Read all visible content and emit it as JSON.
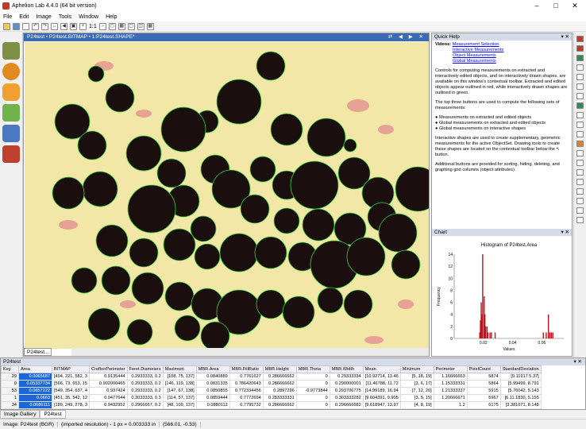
{
  "window": {
    "title": "Aphelion Lab 4.4.0 (64 bit version)"
  },
  "menu": [
    "File",
    "Edit",
    "Image",
    "Tools",
    "Window",
    "Help"
  ],
  "toolbar": {
    "zoom_label": "1:1"
  },
  "document": {
    "title": "P24test • P24test.BITMAP • 1:P24test.SHAPE*",
    "tab": "P24test..."
  },
  "quick_help": {
    "header": "Quick Help",
    "videos_label": "Videos:",
    "links": [
      "Measurement Selection",
      "Interactive Measurements",
      "Object Measurements",
      "Global Measurements"
    ],
    "para1": "Controls for computing measurements on extracted and interactively edited objects, and on interactively drawn shapes, are available on this window's contextual toolbar. Extracted and edited objects appear outlined in red, while interactively drawn shapes are outlined in green.",
    "para2": "The top three buttons are used to compute the following sets of measurements:",
    "bullets": [
      "Measurements on extracted and edited objects",
      "Global measurements on extracted and edited objects",
      "Global measurements on interactive shapes"
    ],
    "para3": "Interactive shapes are used to create supplementary, geometric measurements for the active ObjectSet. Drawing tools to create these shapes are located on the contextual toolbar below the",
    "para3_end": "button.",
    "para4": "Additional buttons are provided for sorting, hiding, deleting, and graphing grid columns (object attributes)."
  },
  "chart_panel": {
    "header": "Chart"
  },
  "chart_data": {
    "type": "bar",
    "title": "Histogram of P24test.Area",
    "xlabel": "Values",
    "ylabel": "Frequency",
    "xlim": [
      0,
      0.075
    ],
    "ylim": [
      0,
      14
    ],
    "x_ticks": [
      "0.02",
      "0.04",
      "0.06"
    ],
    "y_ticks": [
      "0",
      "2",
      "4",
      "6",
      "8",
      "10",
      "12",
      "14"
    ],
    "x": [
      0.0175,
      0.018,
      0.0185,
      0.019,
      0.0195,
      0.0205,
      0.021,
      0.0215,
      0.0225,
      0.023,
      0.0245,
      0.0255,
      0.028,
      0.061,
      0.063,
      0.0645,
      0.0655,
      0.0665,
      0.0675
    ],
    "values": [
      1,
      3,
      6,
      4,
      14,
      7,
      4,
      2,
      2,
      1,
      1,
      1,
      1,
      1,
      1,
      4,
      1,
      1,
      1
    ]
  },
  "table": {
    "title": "P24test",
    "columns": [
      "Key",
      "Area",
      "BITMAP",
      "CroftonPerimeter",
      "Feret.Diameters",
      "Maximum",
      "MBR.Area",
      "MBR.FillRatio",
      "MBR.Height",
      "MBR.Theta",
      "MBR.Width",
      "Mean",
      "Minimum",
      "Perimeter",
      "PixelCount",
      "StandardDeviation"
    ],
    "rows": [
      [
        "29",
        "0.0065687",
        "[494, 221, 582, 3",
        "0.9135444",
        "0.2933333, 0.2",
        "[108, 75, 137]",
        "0.0840889",
        "0.7761627",
        "0.286666662",
        "0",
        "0.29333334",
        "[10.92714, 13.46",
        "[5, 18, 19]",
        "1.16666663",
        "5874",
        "[9.11917 5.37]"
      ],
      [
        "0",
        "0.05337734",
        "[566, 73, 653, 15",
        "0.902000465",
        "0.2933333, 0.2",
        "[146, 119, 138]",
        "0.0831335",
        "0.786420643",
        "0.286666662",
        "0",
        "0.290000001",
        "[11.46788, 11.72",
        "[3, 6, 17]",
        "1.15333331",
        "5864",
        "[5.99499, 8.791"
      ],
      [
        "53",
        "0.0657222",
        "[549, 354, 637, 4",
        "0.937424",
        "0.2933333, 0.2",
        "[147, 67, 138]",
        "0.0850855",
        "0.772334456",
        "0.2897296",
        "-0.9773844",
        "0.293706775",
        "[14.99189, 16.94",
        "[7, 12, 20]",
        "1.21333337",
        "5915",
        "[5.76042, 5.143"
      ],
      [
        "1",
        "0.0663",
        "[451, 35, 542, 12",
        "0.9477644",
        "0.3033333, 0.3",
        "[114, 57, 137]",
        "0.0859444",
        "0.7772654",
        "0.283333331",
        "0",
        "0.303333282",
        "[9.604391, 9.905",
        "[3, 5, 15]",
        "1.20666671",
        "5967",
        "[6.11.1830, 5.155"
      ],
      [
        "34",
        "0.0686111",
        "[189, 249, 278, 3",
        "0.9432952",
        "0.2966667, 0.2",
        "[48, 109, 137]",
        "0.0880112",
        "0.7795732",
        "0.286666662",
        "0",
        "0.296666682",
        "[9.618947, 13.97",
        "[4, 8, 19]",
        "1.2",
        "6175",
        "[3.381071, 8.148"
      ]
    ]
  },
  "gallery_tabs": [
    "Image Gallery",
    "P24test"
  ],
  "status": {
    "image": "Image: P24test (BGR)",
    "resolution": "(imported resolution) - 1 px = 0.003333 in",
    "coords": "(566.01, -0.53)"
  }
}
